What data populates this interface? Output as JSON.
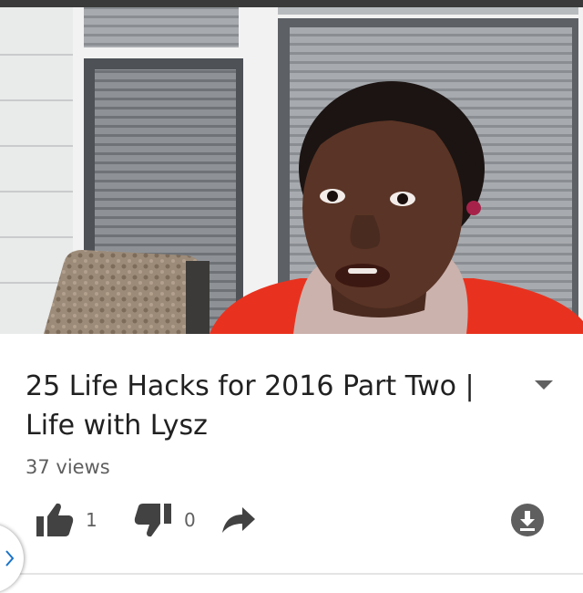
{
  "video": {
    "title": "25 Life Hacks for 2016 Part Two | Life with Lysz",
    "views": "37 views",
    "likes": "1",
    "dislikes": "0"
  },
  "colors": {
    "title": "#212121",
    "secondary": "#606060",
    "icon": "#424242",
    "side_tab_chevron": "#1a73c8"
  },
  "icons": [
    "expand-chevron-icon",
    "thumbs-up-icon",
    "thumbs-down-icon",
    "share-arrow-icon",
    "download-icon",
    "chevron-right-icon"
  ]
}
